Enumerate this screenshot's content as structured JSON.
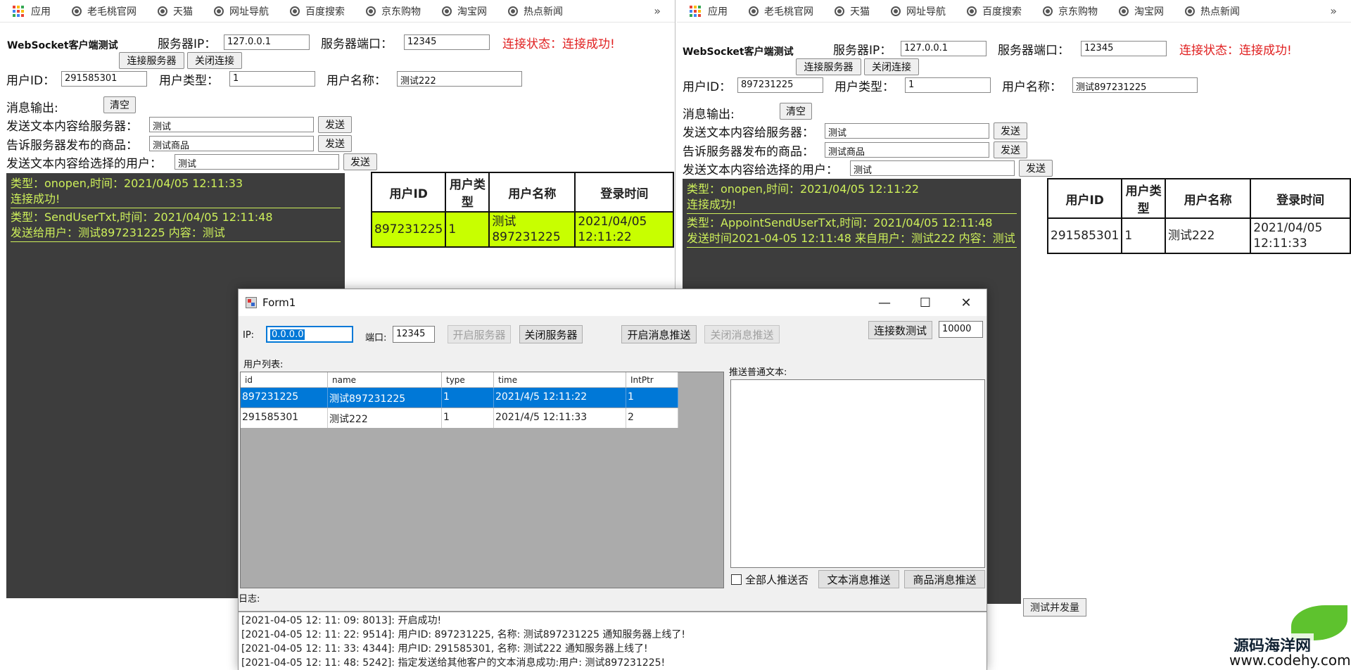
{
  "bookmarks": {
    "items": [
      "应用",
      "老毛桃官网",
      "天猫",
      "网址导航",
      "百度搜索",
      "京东购物",
      "淘宝网",
      "热点新闻"
    ],
    "more": "»"
  },
  "left_client": {
    "title": "WebSocket客户端测试",
    "server_ip_label": "服务器IP：",
    "server_ip": "127.0.0.1",
    "server_port_label": "服务器端口：",
    "server_port": "12345",
    "status": "连接状态：连接成功!",
    "connect_btn": "连接服务器",
    "close_btn": "关闭连接",
    "user_id_label": "用户ID：",
    "user_id": "291585301",
    "user_type_label": "用户类型：",
    "user_type": "1",
    "user_name_label": "用户名称：",
    "user_name": "测试222",
    "msg_output_label": "消息输出:",
    "clear_btn": "清空",
    "send_server_label": "发送文本内容给服务器：",
    "send_server_value": "测试",
    "send_btn": "发送",
    "goods_label": "告诉服务器发布的商品：",
    "goods_value": "测试商品",
    "send_user_label": "发送文本内容给选择的用户：",
    "send_user_value": "测试",
    "console": [
      "类型：onopen,时间：2021/04/05 12:11:33\n连接成功!",
      "类型：SendUserTxt,时间：2021/04/05 12:11:48\n发送给用户：测试897231225 内容：测试"
    ],
    "table_headers": [
      "用户ID",
      "用户类型",
      "用户名称",
      "登录时间"
    ],
    "table_rows": [
      [
        "897231225",
        "1",
        "测试897231225",
        "2021/04/05 12:11:22"
      ]
    ]
  },
  "right_client": {
    "title": "WebSocket客户端测试",
    "server_ip_label": "服务器IP：",
    "server_ip": "127.0.0.1",
    "server_port_label": "服务器端口：",
    "server_port": "12345",
    "status": "连接状态：连接成功!",
    "connect_btn": "连接服务器",
    "close_btn": "关闭连接",
    "user_id_label": "用户ID：",
    "user_id": "897231225",
    "user_type_label": "用户类型：",
    "user_type": "1",
    "user_name_label": "用户名称：",
    "user_name": "测试897231225",
    "msg_output_label": "消息输出:",
    "clear_btn": "清空",
    "send_server_label": "发送文本内容给服务器：",
    "send_server_value": "测试",
    "send_btn": "发送",
    "goods_label": "告诉服务器发布的商品：",
    "goods_value": "测试商品",
    "send_user_label": "发送文本内容给选择的用户：",
    "send_user_value": "测试",
    "console": [
      "类型：onopen,时间：2021/04/05 12:11:22\n连接成功!",
      "类型：AppointSendUserTxt,时间：2021/04/05 12:11:48\n发送时间2021-04-05 12:11:48 来自用户：测试222 内容：测试"
    ],
    "table_headers": [
      "用户ID",
      "用户类型",
      "用户名称",
      "登录时间"
    ],
    "table_rows": [
      [
        "291585301",
        "1",
        "测试222",
        "2021/04/05 12:11:33"
      ]
    ],
    "stress_btn": "测试并发量"
  },
  "form1": {
    "title": "Form1",
    "ip_label": "IP:",
    "ip_value": "0.0.0.0",
    "port_label": "端口:",
    "port_value": "12345",
    "start_server_btn": "开启服务器",
    "stop_server_btn": "关闭服务器",
    "start_push_btn": "开启消息推送",
    "stop_push_btn": "关闭消息推送",
    "conn_test_btn": "连接数测试",
    "conn_count": "10000",
    "user_list_label": "用户列表:",
    "grid_columns": [
      "id",
      "name",
      "type",
      "time",
      "IntPtr"
    ],
    "grid_rows": [
      [
        "897231225",
        "测试897231225",
        "1",
        "2021/4/5 12:11:22",
        "1"
      ],
      [
        "291585301",
        "测试222",
        "1",
        "2021/4/5 12:11:33",
        "2"
      ]
    ],
    "push_text_label": "推送普通文本:",
    "push_all_label": "全部人推送否",
    "text_push_btn": "文本消息推送",
    "goods_push_btn": "商品消息推送",
    "log_label": "日志:",
    "log_lines": [
      "[2021-04-05 12: 11: 09: 8013]: 开启成功!",
      "[2021-04-05 12: 11: 22: 9514]: 用户ID: 897231225, 名称: 测试897231225 通知服务器上线了!",
      "[2021-04-05 12: 11: 33: 4344]: 用户ID: 291585301, 名称: 测试222 通知服务器上线了!",
      "[2021-04-05 12: 11: 48: 5242]: 指定发送给其他客户的文本消息成功:用户: 测试897231225!"
    ]
  },
  "watermark": {
    "title": "源码海洋网",
    "url": "www.codehy.com"
  }
}
